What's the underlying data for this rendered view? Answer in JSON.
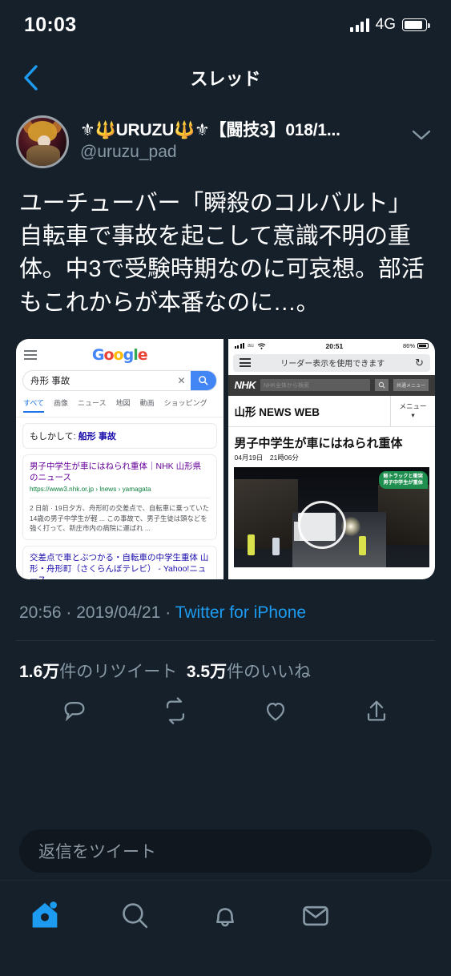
{
  "statusbar": {
    "time": "10:03",
    "network": "4G",
    "signal_icon": "signal-bars-icon",
    "battery_icon": "battery-icon"
  },
  "header": {
    "title": "スレッド",
    "back_icon": "chevron-left-icon"
  },
  "tweet": {
    "display_name": "⚜🔱URUZU🔱⚜【闘技3】018/1...",
    "handle": "@uruzu_pad",
    "caret_icon": "chevron-down-icon",
    "text": "ユーチューバー「瞬殺のコルバルト」\n自転車で事故を起こして意識不明の重体。中3で受験時期なのに可哀想。部活もこれからが本番なのに…。",
    "timestamp": "20:56",
    "date": "2019/04/21",
    "source": "Twitter for iPhone",
    "separator": "·",
    "stats": {
      "retweet_count": "1.6万",
      "retweet_label": "件のリツイート",
      "like_count": "3.5万",
      "like_label": "件のいいね"
    },
    "actions": [
      {
        "name": "reply-action",
        "icon": "reply-icon"
      },
      {
        "name": "retweet-action",
        "icon": "retweet-icon"
      },
      {
        "name": "like-action",
        "icon": "heart-icon"
      },
      {
        "name": "share-action",
        "icon": "share-icon"
      }
    ]
  },
  "media": {
    "google": {
      "menu_icon": "hamburger-icon",
      "logo": [
        "G",
        "o",
        "o",
        "g",
        "l",
        "e"
      ],
      "query": "舟形 事故",
      "clear_icon": "close-icon",
      "search_icon": "search-icon",
      "tabs": [
        "すべて",
        "画像",
        "ニュース",
        "地図",
        "動画",
        "ショッピング"
      ],
      "selected_tab": "すべて",
      "did_you_mean_prefix": "もしかして: ",
      "did_you_mean_term": "船形 事故",
      "results": [
        {
          "title": "男子中学生が車にはねられ重体｜NHK 山形県のニュース",
          "url": "https://www3.nhk.or.jp › lnews › yamagata",
          "snippet": "2 日前 · 19日夕方、舟形町の交差点で、自転車に乗っていた14歳の男子中学生が軽 ... この事故で、男子生徒は頭などを強く打って、新庄市内の病院に運ばれ ..."
        },
        {
          "title": "交差点で車とぶつかる・自転車の中学生重体 山形・舟形町（さくらんぼテレビ） - Yahoo!ニュース",
          "url": "",
          "snippet": ""
        }
      ]
    },
    "nhk": {
      "status_carrier": "au",
      "status_time": "20:51",
      "status_battery": "86%",
      "wifi_icon": "wifi-icon",
      "reader_menu_icon": "hamburger-icon",
      "reader_label": "リーダー表示を使用できます",
      "reload_icon": "reload-icon",
      "brand": "NHK",
      "search_placeholder": "NHK全体から検索",
      "search_icon": "search-icon",
      "common_menu": "共通メニュー",
      "site_title": "山形 NEWS WEB",
      "menu_label": "メニュー",
      "menu_caret": "▾",
      "headline": "男子中学生が車にはねられ重体",
      "published": "04月19日　21時06分",
      "photo_caption_line1": "軽トラックと衝突",
      "photo_caption_line2": "男子中学生が重体"
    }
  },
  "composer": {
    "placeholder": "返信をツイート"
  },
  "tabbar": {
    "items": [
      {
        "name": "tab-home",
        "icon": "home-icon",
        "active": true,
        "badge": true
      },
      {
        "name": "tab-search",
        "icon": "search-icon",
        "active": false
      },
      {
        "name": "tab-notifications",
        "icon": "bell-icon",
        "active": false
      },
      {
        "name": "tab-messages",
        "icon": "mail-icon",
        "active": false
      }
    ]
  },
  "colors": {
    "background": "#15202b",
    "accent": "#1d9bf0",
    "muted": "#8899a6",
    "divider": "#253341"
  }
}
